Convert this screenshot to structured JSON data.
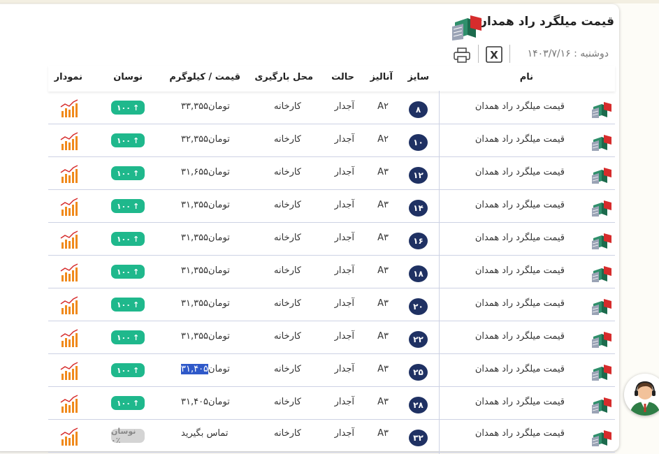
{
  "header": {
    "title": "قیمت میلگرد راد همدان",
    "date": "دوشنبه : ۱۴۰۳/۷/۱۶",
    "tools": [
      "print-icon",
      "excel-icon"
    ]
  },
  "table": {
    "columns": {
      "name": "نام",
      "size": "سایز",
      "analysis": "آنالیز",
      "state": "حالت",
      "location": "محل بارگیری",
      "price": "قیمت / کیلوگرم",
      "change": "نوسان",
      "chart": "نمودار"
    },
    "rows": [
      {
        "name": "قیمت میلگرد راد همدان",
        "size": "۸",
        "analysis": "A۲",
        "state": "آجدار",
        "location": "کارخانه",
        "price_value": "۳۳,۳۵۵",
        "price_unit": "تومان",
        "change": "۱۰۰",
        "change_arrow": "↑"
      },
      {
        "name": "قیمت میلگرد راد همدان",
        "size": "۱۰",
        "analysis": "A۲",
        "state": "آجدار",
        "location": "کارخانه",
        "price_value": "۳۲,۳۵۵",
        "price_unit": "تومان",
        "change": "۱۰۰",
        "change_arrow": "↑"
      },
      {
        "name": "قیمت میلگرد راد همدان",
        "size": "۱۲",
        "analysis": "A۳",
        "state": "آجدار",
        "location": "کارخانه",
        "price_value": "۳۱,۶۵۵",
        "price_unit": "تومان",
        "change": "۱۰۰",
        "change_arrow": "↑"
      },
      {
        "name": "قیمت میلگرد راد همدان",
        "size": "۱۴",
        "analysis": "A۳",
        "state": "آجدار",
        "location": "کارخانه",
        "price_value": "۳۱,۳۵۵",
        "price_unit": "تومان",
        "change": "۱۰۰",
        "change_arrow": "↑"
      },
      {
        "name": "قیمت میلگرد راد همدان",
        "size": "۱۶",
        "analysis": "A۳",
        "state": "آجدار",
        "location": "کارخانه",
        "price_value": "۳۱,۳۵۵",
        "price_unit": "تومان",
        "change": "۱۰۰",
        "change_arrow": "↑"
      },
      {
        "name": "قیمت میلگرد راد همدان",
        "size": "۱۸",
        "analysis": "A۳",
        "state": "آجدار",
        "location": "کارخانه",
        "price_value": "۳۱,۳۵۵",
        "price_unit": "تومان",
        "change": "۱۰۰",
        "change_arrow": "↑"
      },
      {
        "name": "قیمت میلگرد راد همدان",
        "size": "۲۰",
        "analysis": "A۳",
        "state": "آجدار",
        "location": "کارخانه",
        "price_value": "۳۱,۳۵۵",
        "price_unit": "تومان",
        "change": "۱۰۰",
        "change_arrow": "↑"
      },
      {
        "name": "قیمت میلگرد راد همدان",
        "size": "۲۲",
        "analysis": "A۳",
        "state": "آجدار",
        "location": "کارخانه",
        "price_value": "۳۱,۳۵۵",
        "price_unit": "تومان",
        "change": "۱۰۰",
        "change_arrow": "↑"
      },
      {
        "name": "قیمت میلگرد راد همدان",
        "size": "۲۵",
        "analysis": "A۳",
        "state": "آجدار",
        "location": "کارخانه",
        "price_value": "۳۱,۴۰۵",
        "price_unit": "تومان",
        "change": "۱۰۰",
        "change_arrow": "↑",
        "highlighted": true
      },
      {
        "name": "قیمت میلگرد راد همدان",
        "size": "۲۸",
        "analysis": "A۳",
        "state": "آجدار",
        "location": "کارخانه",
        "price_value": "۳۱,۴۰۵",
        "price_unit": "تومان",
        "change": "۱۰۰",
        "change_arrow": "↑"
      },
      {
        "name": "قیمت میلگرد راد همدان",
        "size": "۳۲",
        "analysis": "A۳",
        "state": "آجدار",
        "location": "کارخانه",
        "price_value": "تماس بگیرید",
        "price_unit": "",
        "change": "نوسان ۰٪",
        "change_arrow": ""
      }
    ]
  },
  "colors": {
    "size_badge": "#1f3163",
    "change_badge": "#1fb88c",
    "chart_icon": "#f08a1c",
    "highlight": "#2f59c9"
  },
  "support_widget": {
    "icon": "support-agent-icon"
  }
}
